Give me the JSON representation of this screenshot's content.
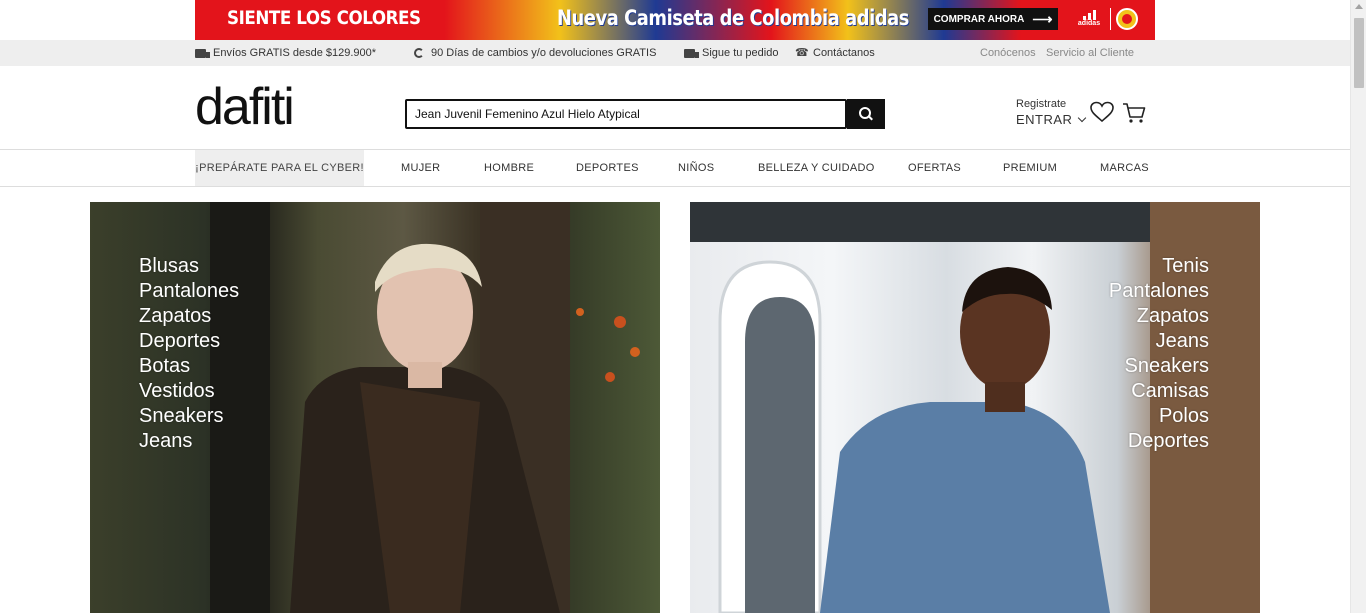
{
  "promo": {
    "left_text": "SIENTE LOS COLORES",
    "center_text": "Nueva Camiseta de Colombia adidas",
    "cta_label": "COMPRAR AHORA",
    "brand_label": "adidas",
    "colors": {
      "red": "#e3141b",
      "yellow": "#f2c11a",
      "blue": "#1f3a93"
    }
  },
  "utility": {
    "shipping": "Envíos GRATIS desde $129.900*",
    "returns": "90 Días de cambios y/o devoluciones GRATIS",
    "track": "Sigue tu pedido",
    "contact": "Contáctanos",
    "about": "Conócenos",
    "customer_service": "Servicio al Cliente",
    "icons": [
      "truck-icon",
      "cycle-icon",
      "truck-icon",
      "phone-icon"
    ]
  },
  "header": {
    "logo": "dafiti",
    "search_value": "Jean Juvenil Femenino Azul Hielo Atypical",
    "register": "Registrate",
    "login": "ENTRAR"
  },
  "nav": {
    "items": [
      "¡PREPÁRATE PARA EL CYBER!",
      "MUJER",
      "HOMBRE",
      "DEPORTES",
      "NIÑOS",
      "BELLEZA Y CUIDADO",
      "OFERTAS",
      "PREMIUM",
      "MARCAS"
    ]
  },
  "hero_women": {
    "links": [
      "Blusas",
      "Pantalones",
      "Zapatos",
      "Deportes",
      "Botas",
      "Vestidos",
      "Sneakers",
      "Jeans"
    ]
  },
  "hero_men": {
    "links": [
      "Tenis",
      "Pantalones",
      "Zapatos",
      "Jeans",
      "Sneakers",
      "Camisas",
      "Polos",
      "Deportes"
    ]
  }
}
